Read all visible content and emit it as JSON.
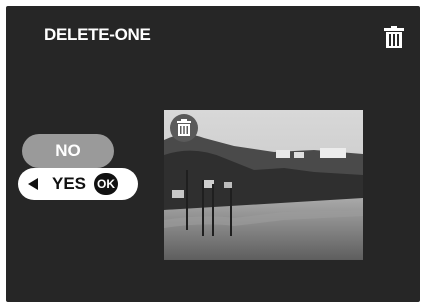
{
  "header": {
    "title": "DELETE-ONE"
  },
  "buttons": {
    "no_label": "NO",
    "yes_label": "YES",
    "ok_label": "OK"
  },
  "icons": {
    "top_right": "trash-icon",
    "photo_overlay": "trash-icon",
    "yes_arrow": "left-arrow-icon"
  }
}
